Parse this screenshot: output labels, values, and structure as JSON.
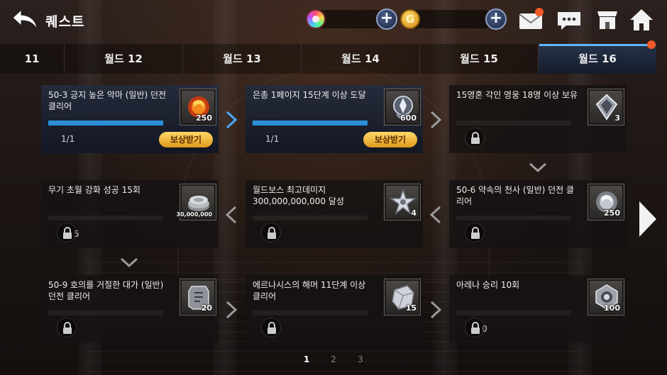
{
  "header": {
    "title": "퀘스트",
    "icons": [
      "back-arrow-icon",
      "rainbow-orb-icon",
      "plus-icon",
      "gold-coin-icon",
      "plus-icon",
      "mail-icon",
      "chat-icon",
      "shop-icon",
      "home-icon"
    ],
    "gold_symbol": "G",
    "plus_symbol": "+"
  },
  "tabs": [
    {
      "label": "11",
      "active": false
    },
    {
      "label": "월드 12",
      "active": false
    },
    {
      "label": "월드 13",
      "active": false
    },
    {
      "label": "월드 14",
      "active": false
    },
    {
      "label": "월드 15",
      "active": false
    },
    {
      "label": "월드 16",
      "active": true
    }
  ],
  "quests": [
    {
      "title": "50-3 긍지 높은 악마 (일반) 던전 클리어",
      "count": "250",
      "icon": "fire-orb-icon",
      "state": "claimable",
      "progress_text": "1/1",
      "progress": 1.0,
      "reward_label": "보상받기"
    },
    {
      "title": "은총 1페이지 15단계 이상 도달",
      "count": "600",
      "icon": "blessing-emblem-icon",
      "state": "claimable",
      "progress_text": "1/1",
      "progress": 1.0,
      "reward_label": "보상받기"
    },
    {
      "title": "15영혼 각인 영웅 18명 이상 보유",
      "count": "3",
      "icon": "soul-crystal-icon",
      "state": "locked",
      "progress_text": "",
      "progress": 0
    },
    {
      "title": "무기 초월 강화 성공 15회",
      "count": "30,000,000",
      "icon": "silver-coins-icon",
      "state": "locked",
      "progress_text": "5",
      "progress": 0
    },
    {
      "title": "월드보스 최고데미지 300,000,000,000 달성",
      "count": "4",
      "icon": "star-crest-icon",
      "state": "locked",
      "progress_text": "",
      "progress": 0
    },
    {
      "title": "50-6 약속의 천사 (일반) 던전 클리어",
      "count": "250",
      "icon": "silver-orb-icon",
      "state": "locked",
      "progress_text": "",
      "progress": 0
    },
    {
      "title": "50-9 호의를 거절한 대가 (일반) 던전 클리어",
      "count": "20",
      "icon": "rune-stone-icon",
      "state": "locked",
      "progress_text": "",
      "progress": 0
    },
    {
      "title": "에르나시스의 해머 11단계 이상 클리어",
      "count": "15",
      "icon": "ore-chunk-icon",
      "state": "locked",
      "progress_text": "",
      "progress": 0
    },
    {
      "title": "아레나 승리 10회",
      "count": "100",
      "icon": "arena-medal-icon",
      "state": "locked",
      "progress_text": "0",
      "progress": 0
    }
  ],
  "pagination": {
    "pages": [
      "1",
      "2",
      "3"
    ],
    "current": "1"
  },
  "colors": {
    "accent": "#62b6ff",
    "progress": "#2a8fd8",
    "reward_button": "#f2b63a",
    "notification": "#f05a28"
  }
}
